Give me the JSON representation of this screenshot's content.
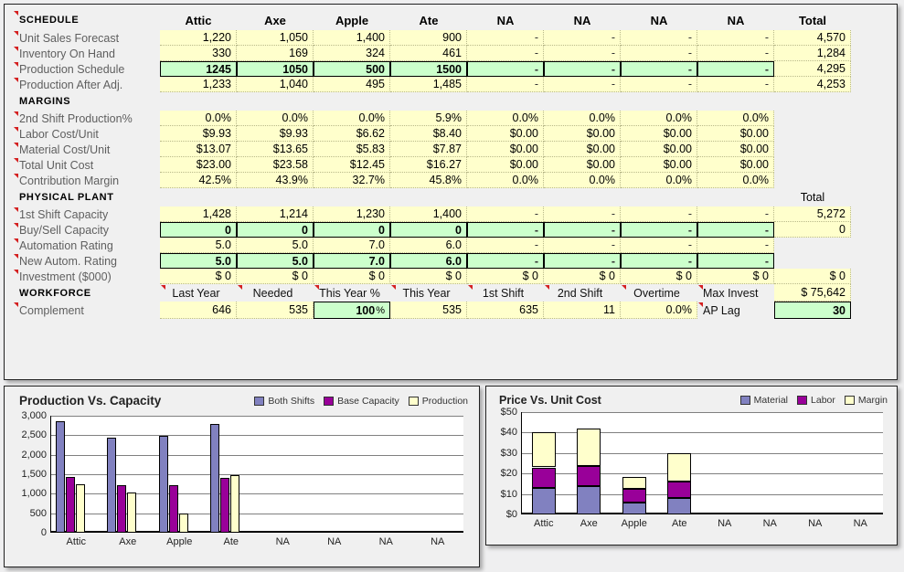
{
  "columns": [
    "Attic",
    "Axe",
    "Apple",
    "Ate",
    "NA",
    "NA",
    "NA",
    "NA"
  ],
  "total_label": "Total",
  "sections": {
    "schedule": {
      "title": "SCHEDULE",
      "rows": [
        {
          "label": "Unit Sales Forecast",
          "style": "yel",
          "values": [
            "1,220",
            "1,050",
            "1,400",
            "900",
            "-",
            "-",
            "-",
            "-"
          ],
          "total": "4,570"
        },
        {
          "label": "Inventory On Hand",
          "style": "yel",
          "values": [
            "330",
            "169",
            "324",
            "461",
            "-",
            "-",
            "-",
            "-"
          ],
          "total": "1,284"
        },
        {
          "label": "Production Schedule",
          "style": "grn",
          "values": [
            "1245",
            "1050",
            "500",
            "1500",
            "-",
            "-",
            "-",
            "-"
          ],
          "total": "4,295"
        },
        {
          "label": "Production After Adj.",
          "style": "yel",
          "values": [
            "1,233",
            "1,040",
            "495",
            "1,485",
            "-",
            "-",
            "-",
            "-"
          ],
          "total": "4,253"
        }
      ]
    },
    "margins": {
      "title": "MARGINS",
      "rows": [
        {
          "label": "2nd Shift Production%",
          "style": "yel",
          "values": [
            "0.0%",
            "0.0%",
            "0.0%",
            "5.9%",
            "0.0%",
            "0.0%",
            "0.0%",
            "0.0%"
          ],
          "total": ""
        },
        {
          "label": "Labor Cost/Unit",
          "style": "yel",
          "values": [
            "$9.93",
            "$9.93",
            "$6.62",
            "$8.40",
            "$0.00",
            "$0.00",
            "$0.00",
            "$0.00"
          ],
          "total": ""
        },
        {
          "label": "Material Cost/Unit",
          "style": "yel",
          "values": [
            "$13.07",
            "$13.65",
            "$5.83",
            "$7.87",
            "$0.00",
            "$0.00",
            "$0.00",
            "$0.00"
          ],
          "total": ""
        },
        {
          "label": "Total Unit Cost",
          "style": "yel",
          "values": [
            "$23.00",
            "$23.58",
            "$12.45",
            "$16.27",
            "$0.00",
            "$0.00",
            "$0.00",
            "$0.00"
          ],
          "total": ""
        },
        {
          "label": "Contribution Margin",
          "style": "yel",
          "values": [
            "42.5%",
            "43.9%",
            "32.7%",
            "45.8%",
            "0.0%",
            "0.0%",
            "0.0%",
            "0.0%"
          ],
          "total": ""
        }
      ]
    },
    "physical_plant": {
      "title": "PHYSICAL PLANT",
      "total_label": "Total",
      "rows": [
        {
          "label": "1st Shift Capacity",
          "style": "yel",
          "values": [
            "1,428",
            "1,214",
            "1,230",
            "1,400",
            "-",
            "-",
            "-",
            "-"
          ],
          "total": "5,272"
        },
        {
          "label": "Buy/Sell Capacity",
          "style": "grn",
          "values": [
            "0",
            "0",
            "0",
            "0",
            "-",
            "-",
            "-",
            "-"
          ],
          "total": "0"
        },
        {
          "label": "Automation Rating",
          "style": "yel",
          "values": [
            "5.0",
            "5.0",
            "7.0",
            "6.0",
            "-",
            "-",
            "-",
            "-"
          ],
          "total": ""
        },
        {
          "label": "New Autom. Rating",
          "style": "grn",
          "values": [
            "5.0",
            "5.0",
            "7.0",
            "6.0",
            "-",
            "-",
            "-",
            "-"
          ],
          "total": ""
        },
        {
          "label": "Investment ($000)",
          "style": "yel",
          "values": [
            "$ 0",
            "$ 0",
            "$ 0",
            "$ 0",
            "$ 0",
            "$ 0",
            "$ 0",
            "$ 0"
          ],
          "total": "$ 0"
        }
      ]
    },
    "workforce": {
      "title": "WORKFORCE",
      "header_cells": [
        "Last Year",
        "Needed",
        "This Year %",
        "This Year",
        "1st Shift",
        "2nd Shift",
        "Overtime"
      ],
      "max_invest_label": "Max Invest",
      "max_invest_value": "$ 75,642",
      "row_label": "Complement",
      "values": [
        "646",
        "535",
        "100",
        "535",
        "635",
        "11",
        "0.0%"
      ],
      "percent_symbol": "%",
      "ap_lag_label": "AP Lag",
      "ap_lag_value": "30"
    }
  },
  "chart_data": [
    {
      "type": "bar",
      "title": "Production Vs. Capacity",
      "categories": [
        "Attic",
        "Axe",
        "Apple",
        "Ate",
        "NA",
        "NA",
        "NA",
        "NA"
      ],
      "series": [
        {
          "name": "Both Shifts",
          "color": "#8181c0",
          "values": [
            2856,
            2428,
            2490,
            2800,
            0,
            0,
            0,
            0
          ]
        },
        {
          "name": "Base Capacity",
          "color": "#990099",
          "values": [
            1428,
            1214,
            1230,
            1400,
            0,
            0,
            0,
            0
          ]
        },
        {
          "name": "Production",
          "color": "#ffffcc",
          "values": [
            1233,
            1040,
            495,
            1485,
            0,
            0,
            0,
            0
          ]
        }
      ],
      "yticks": [
        "0",
        "500",
        "1,000",
        "1,500",
        "2,000",
        "2,500",
        "3,000"
      ],
      "ylim": [
        0,
        3000
      ],
      "xlabel": "",
      "ylabel": "",
      "grid": true,
      "legend_position": "top-right"
    },
    {
      "type": "bar",
      "title": "Price Vs. Unit Cost",
      "stacked": true,
      "categories": [
        "Attic",
        "Axe",
        "Apple",
        "Ate",
        "NA",
        "NA",
        "NA",
        "NA"
      ],
      "series": [
        {
          "name": "Material",
          "color": "#8181c0",
          "values": [
            13.07,
            13.65,
            5.83,
            7.87,
            0,
            0,
            0,
            0
          ]
        },
        {
          "name": "Labor",
          "color": "#990099",
          "values": [
            9.93,
            9.93,
            6.62,
            8.4,
            0,
            0,
            0,
            0
          ]
        },
        {
          "name": "Margin",
          "color": "#ffffcc",
          "values": [
            17.0,
            18.42,
            6.05,
            13.73,
            0,
            0,
            0,
            0
          ]
        }
      ],
      "yticks": [
        "$0",
        "$10",
        "$20",
        "$30",
        "$40",
        "$50"
      ],
      "ylim": [
        0,
        50
      ],
      "xlabel": "",
      "ylabel": "",
      "grid": true,
      "legend_position": "top-right"
    }
  ]
}
